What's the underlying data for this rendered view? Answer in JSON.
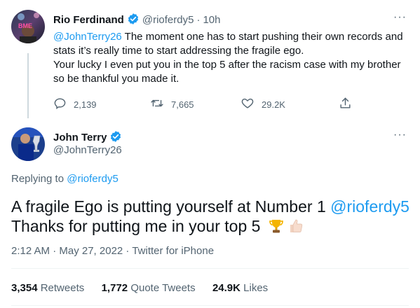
{
  "reply_tweet": {
    "name": "Rio Ferdinand",
    "handle": "@rioferdy5",
    "separator": "·",
    "time": "10h",
    "avatar_overlay_text": "BME",
    "mention": "@JohnTerry26",
    "text_line1": " The moment one has to start pushing their own records and",
    "text_line2": "stats it’s really time to start addressing the fragile ego.",
    "text_line3": "Your lucky I even put you in the top 5 after the racism case with my brother",
    "text_line4": "so be thankful you made it.",
    "replies": "2,139",
    "retweets": "7,665",
    "likes": "29.2K",
    "more_label": "···"
  },
  "main_tweet": {
    "name": "John Terry",
    "handle": "@JohnTerry26",
    "more_label": "···",
    "replying_prefix": "Replying to ",
    "replying_to": "@rioferdy5",
    "text_part1": "A fragile Ego is putting yourself at Number 1 ",
    "text_mention": "@rioferdy5",
    "text_line2": "Thanks for putting me in your top 5 ",
    "emoji_trophy": "trophy-icon",
    "emoji_thumbs": "thumbs-up-icon",
    "timestamp": "2:12 AM · May 27, 2022 · Twitter for iPhone",
    "stats": {
      "retweets_count": "3,354",
      "retweets_label": "Retweets",
      "quotes_count": "1,772",
      "quotes_label": "Quote Tweets",
      "likes_count": "24.9K",
      "likes_label": "Likes"
    }
  },
  "colors": {
    "link": "#1d9bf0",
    "muted": "#536471",
    "text": "#0f1419",
    "divider": "#eff3f4",
    "verified": "#1d9bf0"
  }
}
